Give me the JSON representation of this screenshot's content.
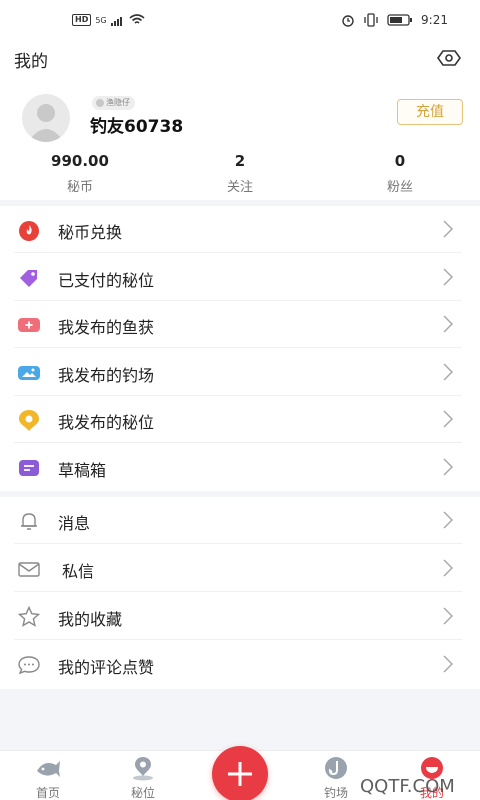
{
  "status_bar": {
    "network": "5G",
    "time": "9:21"
  },
  "header": {
    "title": "我的",
    "eye_icon": "eye-icon"
  },
  "profile": {
    "tag": "渔隐仔",
    "username": "钓友60738",
    "recharge_label": "充值",
    "stats": [
      {
        "value": "990.00",
        "label": "秘币"
      },
      {
        "value": "2",
        "label": "关注"
      },
      {
        "value": "0",
        "label": "粉丝"
      }
    ]
  },
  "menu_primary": [
    {
      "label": "秘币兑换",
      "icon": "flame-coin-icon",
      "color": "#e8413a"
    },
    {
      "label": "已支付的秘位",
      "icon": "tag-icon",
      "color": "#a25ee0"
    },
    {
      "label": "我发布的鱼获",
      "icon": "add-photo-icon",
      "color": "#f06e7a"
    },
    {
      "label": "我发布的钓场",
      "icon": "landscape-icon",
      "color": "#4aa8e8"
    },
    {
      "label": "我发布的秘位",
      "icon": "location-bubble-icon",
      "color": "#f2b62b"
    },
    {
      "label": "草稿箱",
      "icon": "draft-icon",
      "color": "#8b5bd8"
    }
  ],
  "menu_secondary": [
    {
      "label": "消息",
      "icon": "bell-icon"
    },
    {
      "label": "私信",
      "icon": "mail-icon"
    },
    {
      "label": "我的收藏",
      "icon": "star-icon"
    },
    {
      "label": "我的评论点赞",
      "icon": "comment-icon"
    }
  ],
  "tabbar": {
    "tabs": [
      {
        "label": "首页",
        "icon": "fish-icon"
      },
      {
        "label": "秘位",
        "icon": "map-pin-icon"
      },
      {
        "label": "钓场",
        "icon": "fishing-hook-icon"
      },
      {
        "label": "我的",
        "icon": "profile-icon",
        "active": true
      }
    ],
    "add_icon": "plus-icon",
    "accent": "#e83b43"
  },
  "watermark": "QQTF.COM"
}
